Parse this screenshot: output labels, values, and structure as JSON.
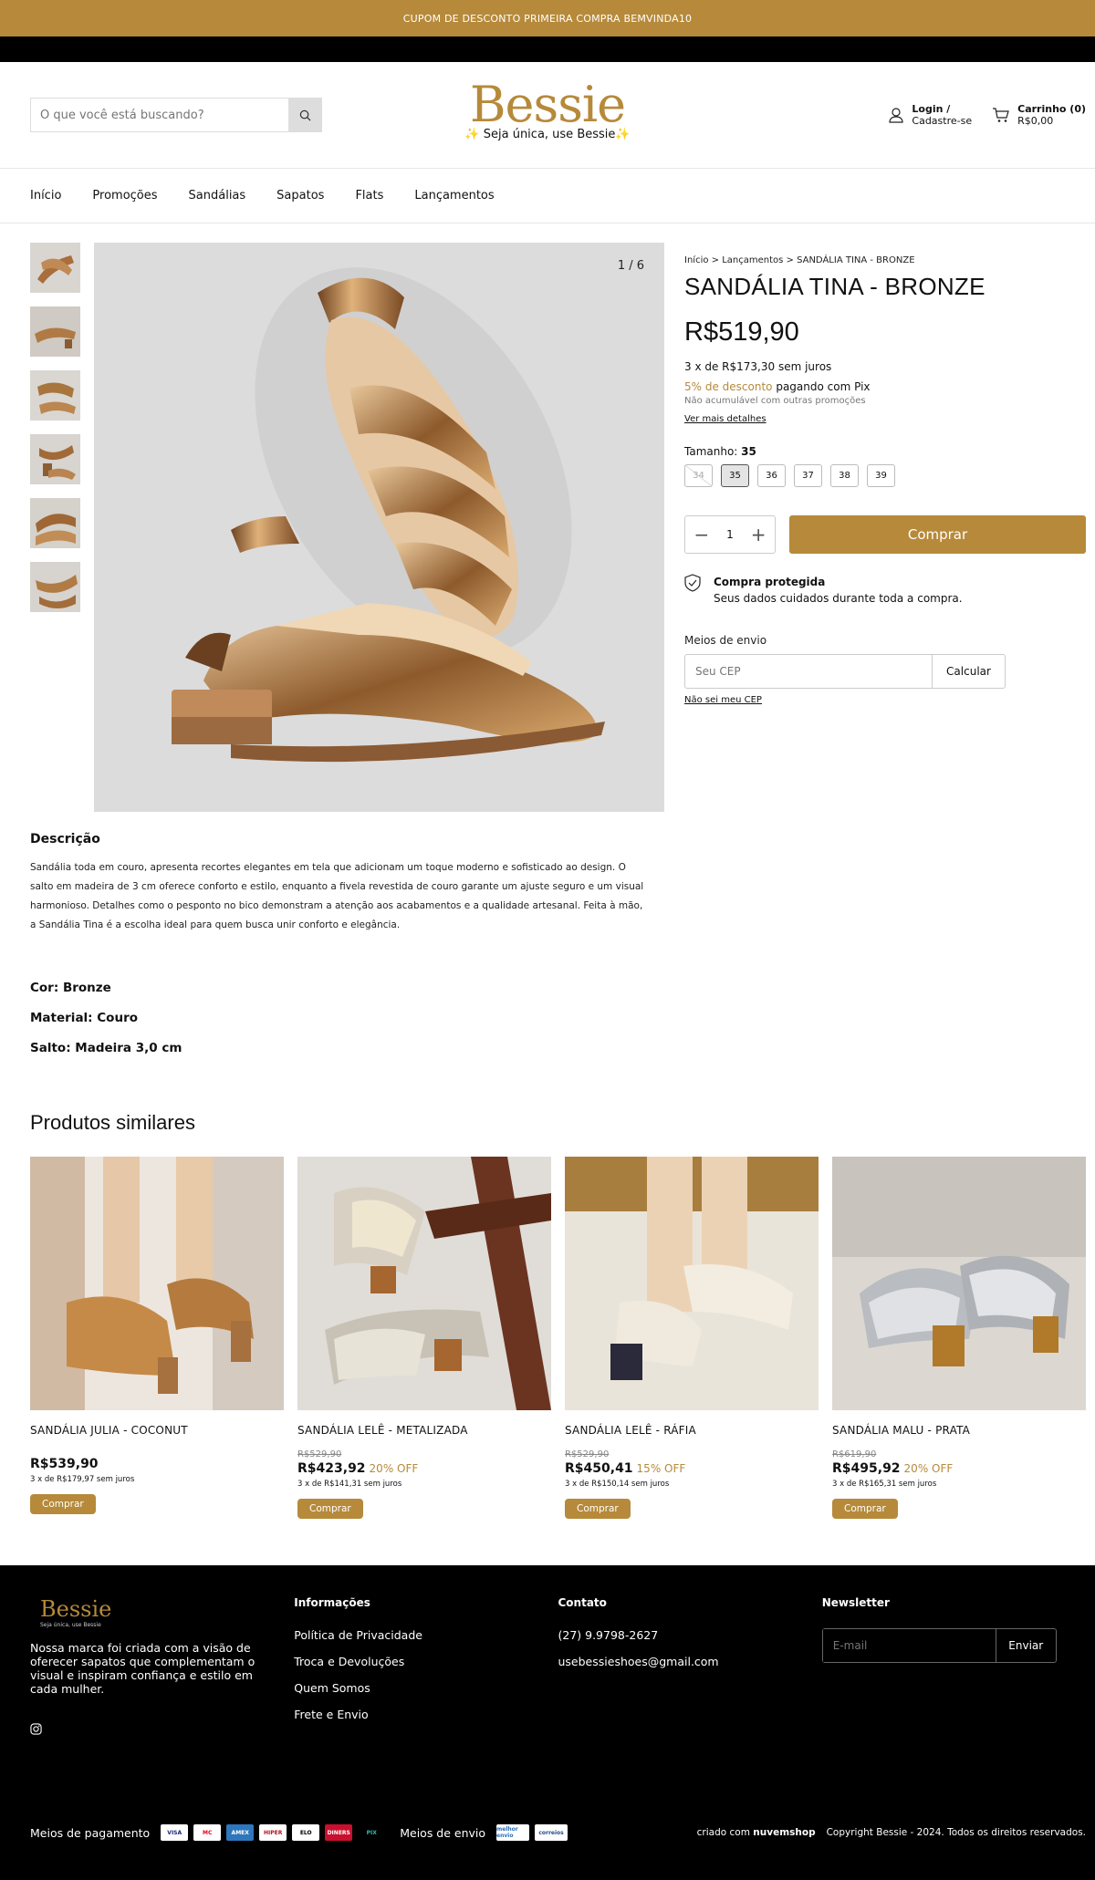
{
  "announcement": "CUPOM DE DESCONTO PRIMEIRA COMPRA BEMVINDA10",
  "header": {
    "search_placeholder": "O que você está buscando?",
    "logo": "Bessie",
    "tagline": "Seja única, use Bessie",
    "login_line1": "Login /",
    "login_line2": "Cadastre-se",
    "cart_line1": "Carrinho (0)",
    "cart_line2": "R$0,00"
  },
  "nav": [
    "Início",
    "Promoções",
    "Sandálias",
    "Sapatos",
    "Flats",
    "Lançamentos"
  ],
  "product": {
    "image_counter": "1 / 6",
    "breadcrumb": "Início > Lançamentos > SANDÁLIA TINA - BRONZE",
    "title": "SANDÁLIA TINA - BRONZE",
    "price": "R$519,90",
    "installments": "3 x de R$173,30 sem juros",
    "pix_discount": "5% de desconto",
    "pix_text": " pagando com Pix",
    "not_cumulative": "Não acumulável com outras promoções",
    "more_details": "Ver mais detalhes",
    "size_label": "Tamanho: ",
    "size_selected": "35",
    "sizes": [
      "34",
      "35",
      "36",
      "37",
      "38",
      "39"
    ],
    "quantity": "1",
    "buy_label": "Comprar",
    "protected_title": "Compra protegida",
    "protected_text": "Seus dados cuidados durante toda a compra.",
    "shipping_label": "Meios de envio",
    "cep_placeholder": "Seu CEP",
    "calc_label": "Calcular",
    "no_cep": "Não sei meu CEP"
  },
  "description": {
    "heading": "Descrição",
    "text": "Sandália toda em couro, apresenta recortes elegantes em tela que adicionam um toque moderno e sofisticado ao design. O salto em madeira de 3 cm oferece conforto e estilo, enquanto a fivela revestida de couro garante um ajuste seguro e um visual harmonioso. Detalhes como o pesponto no bico demonstram a atenção aos acabamentos e a qualidade artesanal. Feita à mão, a Sandália Tina é a escolha ideal para quem busca unir conforto e elegância.",
    "color": "Cor: Bronze",
    "material": "Material: Couro",
    "heel": "Salto: Madeira 3,0 cm"
  },
  "similar": {
    "heading": "Produtos similares",
    "items": [
      {
        "name": "SANDÁLIA JULIA - COCONUT",
        "old": "",
        "price": "R$539,90",
        "off": "",
        "inst": "3 x de R$179,97 sem juros",
        "btn": "Comprar"
      },
      {
        "name": "SANDÁLIA LELÊ - METALIZADA",
        "old": "R$529,90",
        "price": "R$423,92",
        "off": "20% OFF",
        "inst": "3 x de R$141,31 sem juros",
        "btn": "Comprar"
      },
      {
        "name": "SANDÁLIA LELÊ - RÁFIA",
        "old": "R$529,90",
        "price": "R$450,41",
        "off": "15% OFF",
        "inst": "3 x de R$150,14 sem juros",
        "btn": "Comprar"
      },
      {
        "name": "SANDÁLIA MALU - PRATA",
        "old": "R$619,90",
        "price": "R$495,92",
        "off": "20% OFF",
        "inst": "3 x de R$165,31 sem juros",
        "btn": "Comprar"
      }
    ]
  },
  "footer": {
    "logo": "Bessie",
    "logo_tag": "Seja única, use Bessie",
    "about": "Nossa marca foi criada com a visão de oferecer sapatos que complementam o visual e inspiram confiança e estilo em cada mulher.",
    "info_heading": "Informações",
    "info_links": [
      "Política de Privacidade",
      "Troca e Devoluções",
      "Quem Somos",
      "Frete e Envio"
    ],
    "contact_heading": "Contato",
    "phone": "(27) 9.9798-2627",
    "email": "usebessieshoes@gmail.com",
    "newsletter_heading": "Newsletter",
    "newsletter_placeholder": "E-mail",
    "newsletter_btn": "Enviar",
    "payment_label": "Meios de pagamento",
    "payment_methods": [
      "VISA",
      "MC",
      "AMEX",
      "HIPER",
      "ELO",
      "DINERS",
      "PIX"
    ],
    "shipping_label": "Meios de envio",
    "shipping_methods": [
      "melhor envio",
      "correios"
    ],
    "created_by": "criado com",
    "platform": "nuvemshop",
    "copyright": "Copyright Bessie - 2024. Todos os direitos reservados."
  },
  "colors": {
    "accent": "#b68a3a",
    "footer": "#000000"
  }
}
